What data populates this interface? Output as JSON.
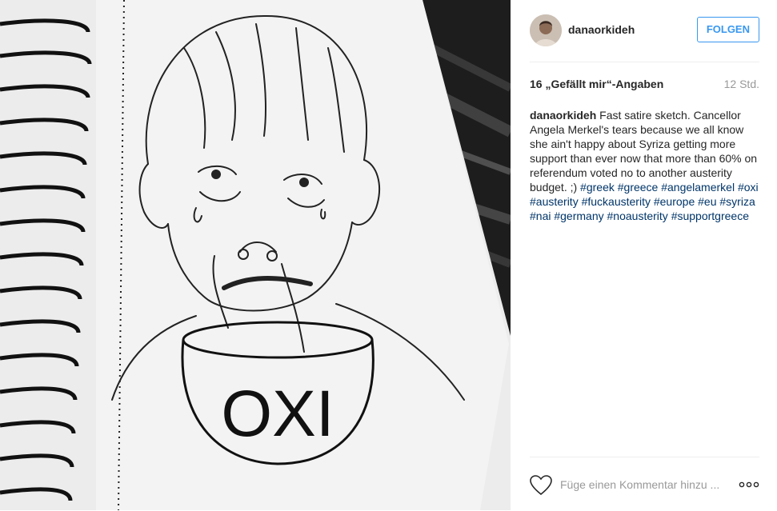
{
  "post": {
    "image_alt": "Sketch of a crying face with a bowl labeled OXI",
    "image_text": "OXI"
  },
  "header": {
    "username": "danaorkideh",
    "follow_label": "FOLGEN"
  },
  "meta": {
    "likes": "16 „Gefällt mir“-Angaben",
    "time": "12 Std."
  },
  "caption": {
    "username": "danaorkideh",
    "text": "Fast satire sketch. Cancellor Angela Merkel's tears because we all know she ain't happy about Syriza getting more support than ever now that more than 60% on referendum voted no to another austerity budget. ;)",
    "hashtags": [
      "#greek",
      "#greece",
      "#angelamerkel",
      "#oxi",
      "#austerity",
      "#fuckausterity",
      "#europe",
      "#eu",
      "#syriza",
      "#nai",
      "#germany",
      "#noausterity",
      "#supportgreece"
    ]
  },
  "footer": {
    "comment_placeholder": "Füge einen Kommentar hinzu ...",
    "more_icon": "more-options-icon",
    "like_icon": "heart-outline-icon"
  },
  "colors": {
    "link": "#003569",
    "follow": "#3897f0",
    "muted": "#999999",
    "text": "#262626",
    "border": "#efefef"
  }
}
